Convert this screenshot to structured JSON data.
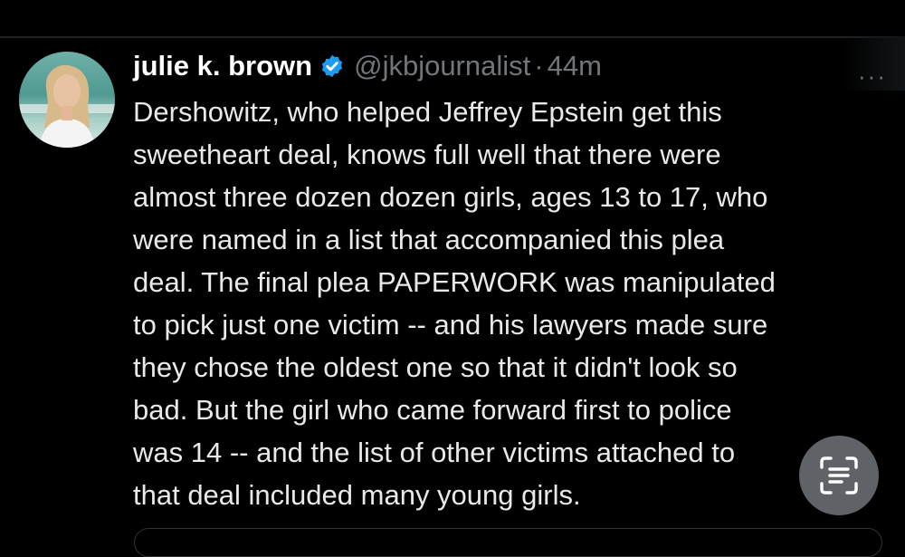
{
  "tweet": {
    "display_name": "julie k. brown",
    "handle": "@jkbjournalist",
    "separator": "·",
    "time": "44m",
    "lines": [
      "Dershowitz, who helped Jeffrey Epstein get this",
      "sweetheart deal, knows full well that there were",
      "almost three dozen dozen girls, ages 13 to 17, who",
      "were named in a list that accompanied this plea",
      "deal. The final plea PAPERWORK was manipulated",
      "to pick just one victim -- and his lawyers made sure",
      "they chose the oldest one so that it didn't look so",
      "bad. But the girl who came forward first to police",
      "was 14 -- and the list of other victims attached to",
      "that deal included many young girls."
    ]
  },
  "icons": {
    "verified": "verified-badge-icon",
    "more": "more-options-icon",
    "scan": "text-scan-icon"
  },
  "colors": {
    "background": "#000000",
    "text": "#e7e9ea",
    "muted": "#71767b",
    "verified_blue": "#1d9bf0"
  }
}
